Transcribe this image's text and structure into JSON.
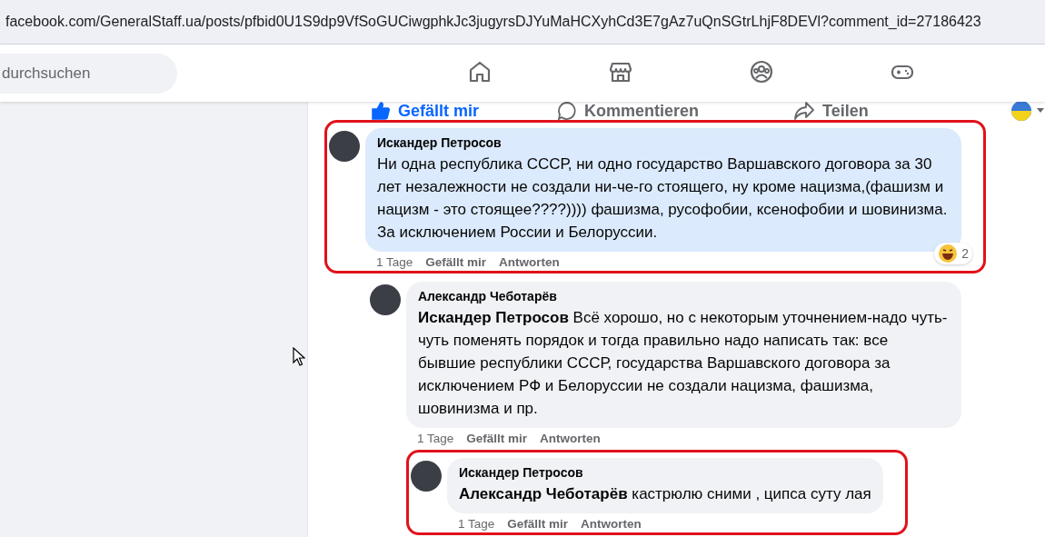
{
  "address_bar": {
    "url": "facebook.com/GeneralStaff.ua/posts/pfbid0U1S9dp9VfSoGUCiwgphkJc3jugyrsDJYuMaHCXyhCd3E7gAz7uQnSGtrLhjF8DEVl?comment_id=27186423"
  },
  "header": {
    "search": {
      "placeholder": "durchsuchen"
    },
    "nav": [
      {
        "kind": "home",
        "selected": false
      },
      {
        "kind": "store",
        "selected": false
      },
      {
        "kind": "groups",
        "selected": false
      },
      {
        "kind": "games",
        "selected": false
      }
    ]
  },
  "post_actions": [
    {
      "kind": "like",
      "label": "Gefällt mir",
      "selected": true
    },
    {
      "kind": "comment",
      "label": "Kommentieren",
      "selected": false
    },
    {
      "kind": "share",
      "label": "Teilen",
      "selected": false
    }
  ],
  "comments": [
    {
      "author": "Искандер Петросов",
      "text": "Ни одна республика СССР, ни одно государство Варшавского договора за 30 лет незалежности не создали ни-че-го стоящего, ну кроме нацизма,(фашизм и нацизм - это стоящее????)))) фашизма, русофобии, ксенофобии и шовинизма. За исключением России и Белоруссии.",
      "age": "1 Tage",
      "like": "Gefällt mir",
      "reply": "Antworten",
      "reactions": "2",
      "highlighted": true,
      "focused": true,
      "children": [
        {
          "author": "Александр Чеботарёв",
          "text": "**Искандер Петросов** Всё хорошо, но с некоторым уточнением-надо чуть-чуть поменять порядок и тогда правильно надо написать так: все бывшие республики СССР, государства Варшавского договора за исключением РФ и Белоруссии не создали нацизма, фашизма, шовинизма и пр.",
          "age": "1 Tage",
          "like": "Gefällt mir",
          "reply": "Antworten",
          "highlighted": false,
          "focused": false,
          "children": [
            {
              "author": "Искандер Петросов",
              "text": "**Александр Чеботарёв** кастрюлю сними , ципса суту лая",
              "age": "1 Tage",
              "like": "Gefällt mir",
              "reply": "Antworten",
              "highlighted": true,
              "focused": false
            }
          ]
        }
      ]
    }
  ]
}
